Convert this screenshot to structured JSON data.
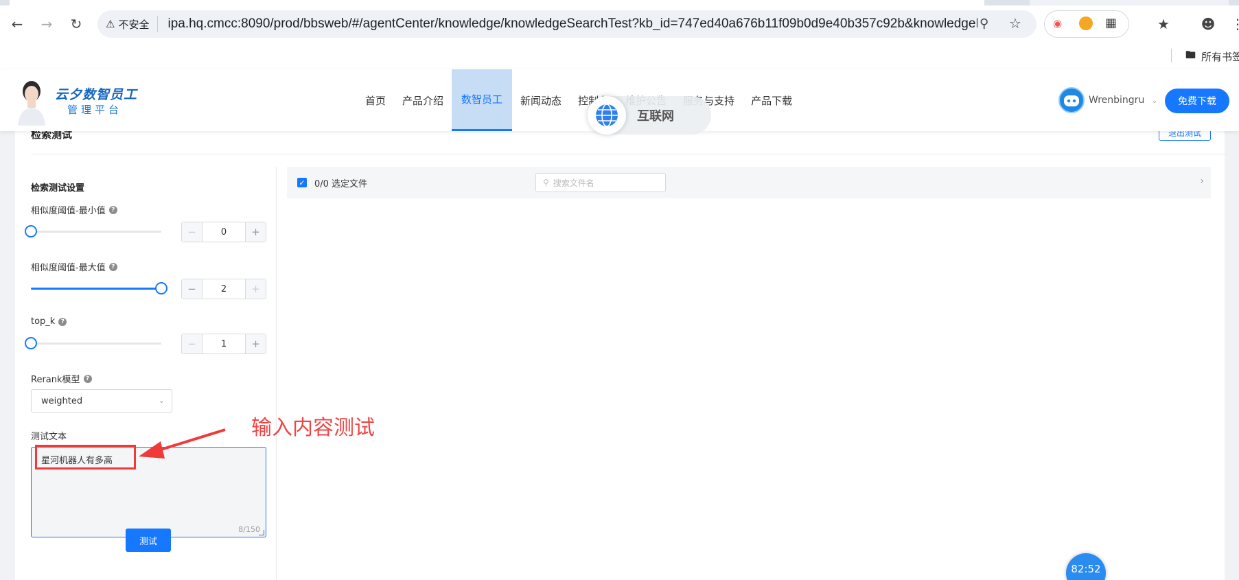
{
  "browser": {
    "security_label": "不安全",
    "url": "ipa.hq.cmcc:8090/prod/bbsweb/#/agentCenter/knowledge/knowledgeSearchTest?kb_id=747ed40a676b11f09b0d9e40b357c92b&knowledgeNam...",
    "bookmarks_folder": "所有书签"
  },
  "header": {
    "logo_title": "云夕数智员工",
    "logo_subtitle": "管理平台",
    "nav": [
      "首页",
      "产品介绍",
      "数智员工",
      "新闻动态",
      "控制台",
      "维护公告",
      "服务与支持",
      "产品下载"
    ],
    "active_nav": "数智员工",
    "username": "Wrenbingru",
    "download_label": "免费下载"
  },
  "watermark": {
    "label": "互联网"
  },
  "page": {
    "title": "检索测试",
    "exit_label": "退出测试"
  },
  "settings": {
    "heading": "检索测试设置",
    "min_label": "相似度阈值-最小值",
    "min_value": "0",
    "min_fraction": 0,
    "max_label": "相似度阈值-最大值",
    "max_value": "2",
    "max_fraction": 1,
    "topk_label": "top_k",
    "topk_value": "1",
    "topk_fraction": 0,
    "rerank_label": "Rerank模型",
    "rerank_value": "weighted",
    "text_label": "测试文本",
    "text_value": "星河机器人有多高",
    "text_count": "8/150",
    "test_button": "测试"
  },
  "files": {
    "selected_label": "0/0 选定文件",
    "search_placeholder": "搜索文件名"
  },
  "annotation": {
    "text": "输入内容测试"
  },
  "timer": "82:52",
  "colors": {
    "primary": "#1677ff",
    "annotation": "#f03a3a"
  }
}
